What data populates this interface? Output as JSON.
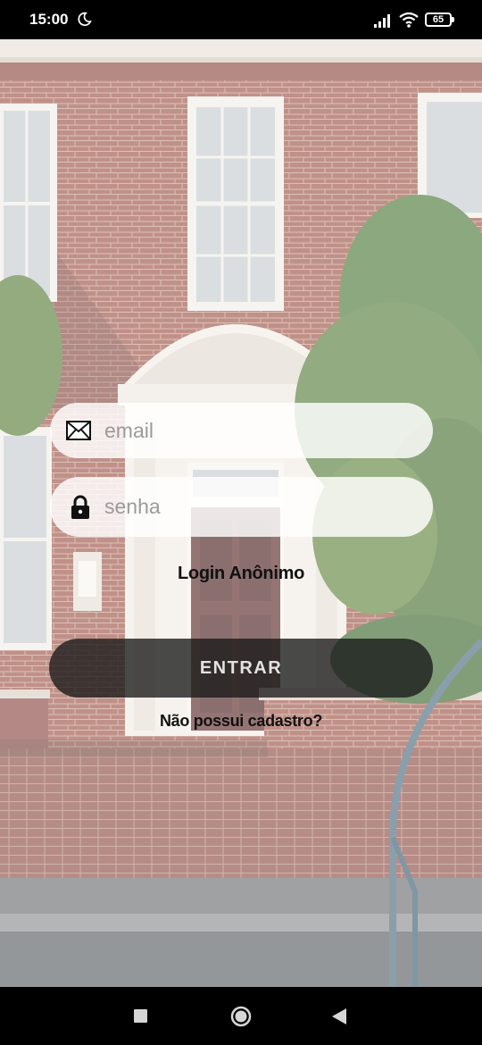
{
  "status_bar": {
    "time": "15:00",
    "battery": "65",
    "icons": [
      "moon-icon",
      "signal-icon",
      "wifi-icon",
      "battery-icon"
    ]
  },
  "background": {
    "description_icon": "building-photo",
    "brick_color": "#a0564b",
    "overlay_color": "#ffffff"
  },
  "login_form": {
    "email": {
      "placeholder": "email",
      "value": "",
      "icon": "envelope-icon"
    },
    "password": {
      "placeholder": "senha",
      "value": "",
      "icon": "lock-icon"
    },
    "anonymous_login_label": "Login Anônimo",
    "submit_label": "ENTRAR",
    "signup_label": "Não possui cadastro?"
  },
  "nav_bar": {
    "icons": [
      "recents-icon",
      "home-icon",
      "back-icon"
    ]
  }
}
